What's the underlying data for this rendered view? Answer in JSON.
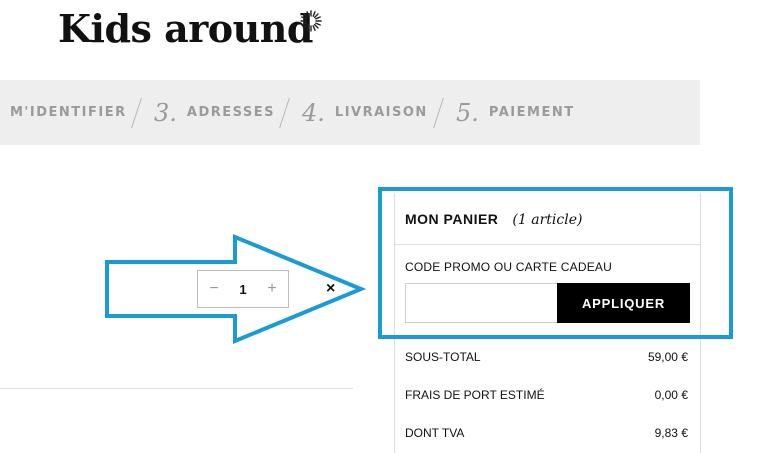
{
  "brand": {
    "name": "Kids around",
    "mark_icon": "sunburst-icon"
  },
  "steps": [
    {
      "num": "",
      "label": "M'IDENTIFIER"
    },
    {
      "num": "3.",
      "label": "ADRESSES"
    },
    {
      "num": "4.",
      "label": "LIVRAISON"
    },
    {
      "num": "5.",
      "label": "PAIEMENT"
    }
  ],
  "quantity": {
    "minus": "−",
    "value": "1",
    "plus": "+"
  },
  "remove_icon": "×",
  "cart": {
    "title": "MON PANIER",
    "count": "(1 article)",
    "promo_label": "CODE PROMO OU CARTE CADEAU",
    "promo_input_value": "",
    "apply_label": "APPLIQUER"
  },
  "totals": [
    {
      "label": "SOUS-TOTAL",
      "value": "59,00 €"
    },
    {
      "label": "FRAIS DE PORT ESTIMÉ",
      "value": "0,00 €"
    },
    {
      "label": "DONT TVA",
      "value": "9,83 €"
    }
  ],
  "colors": {
    "annotation": "#1a9bd7",
    "step_text": "#9a9a9a",
    "step_bar": "#eeeeee",
    "button": "#000000"
  }
}
